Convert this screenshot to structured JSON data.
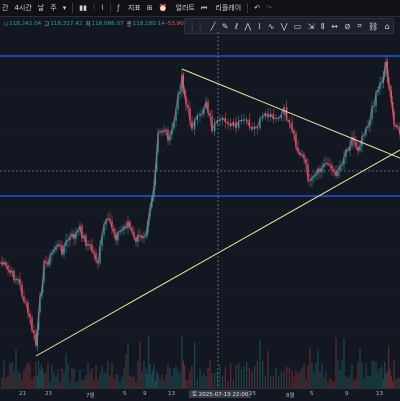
{
  "toolbar": {
    "interval_prefix": "간",
    "interval": "4시간",
    "interval_day": "날",
    "interval_week": "주",
    "indicators": "지표",
    "alert": "얼러트",
    "replay": "리플레이"
  },
  "ohlc": {
    "marker": "시",
    "open": "118,242.04",
    "high_label": "고",
    "high": "118,317.42",
    "low_label": "저",
    "low": "118,086.07",
    "close_label": "종",
    "close": "118,180.14",
    "change": "-53.90"
  },
  "xaxis": {
    "labels": [
      "21",
      "23",
      "7월",
      "5",
      "9",
      "13",
      "토",
      "2025-07-19",
      "22:00",
      "25",
      "8월",
      "5",
      "9",
      "13"
    ],
    "crosshair": "토 2025-07-19  22:00"
  },
  "colors": {
    "background": "#131722",
    "candle_up": "#26a69a",
    "candle_down": "#ef5350",
    "price_line": "#c5568f",
    "trendline": "#e8e4a0",
    "horizontal_line": "#2962ff"
  }
}
